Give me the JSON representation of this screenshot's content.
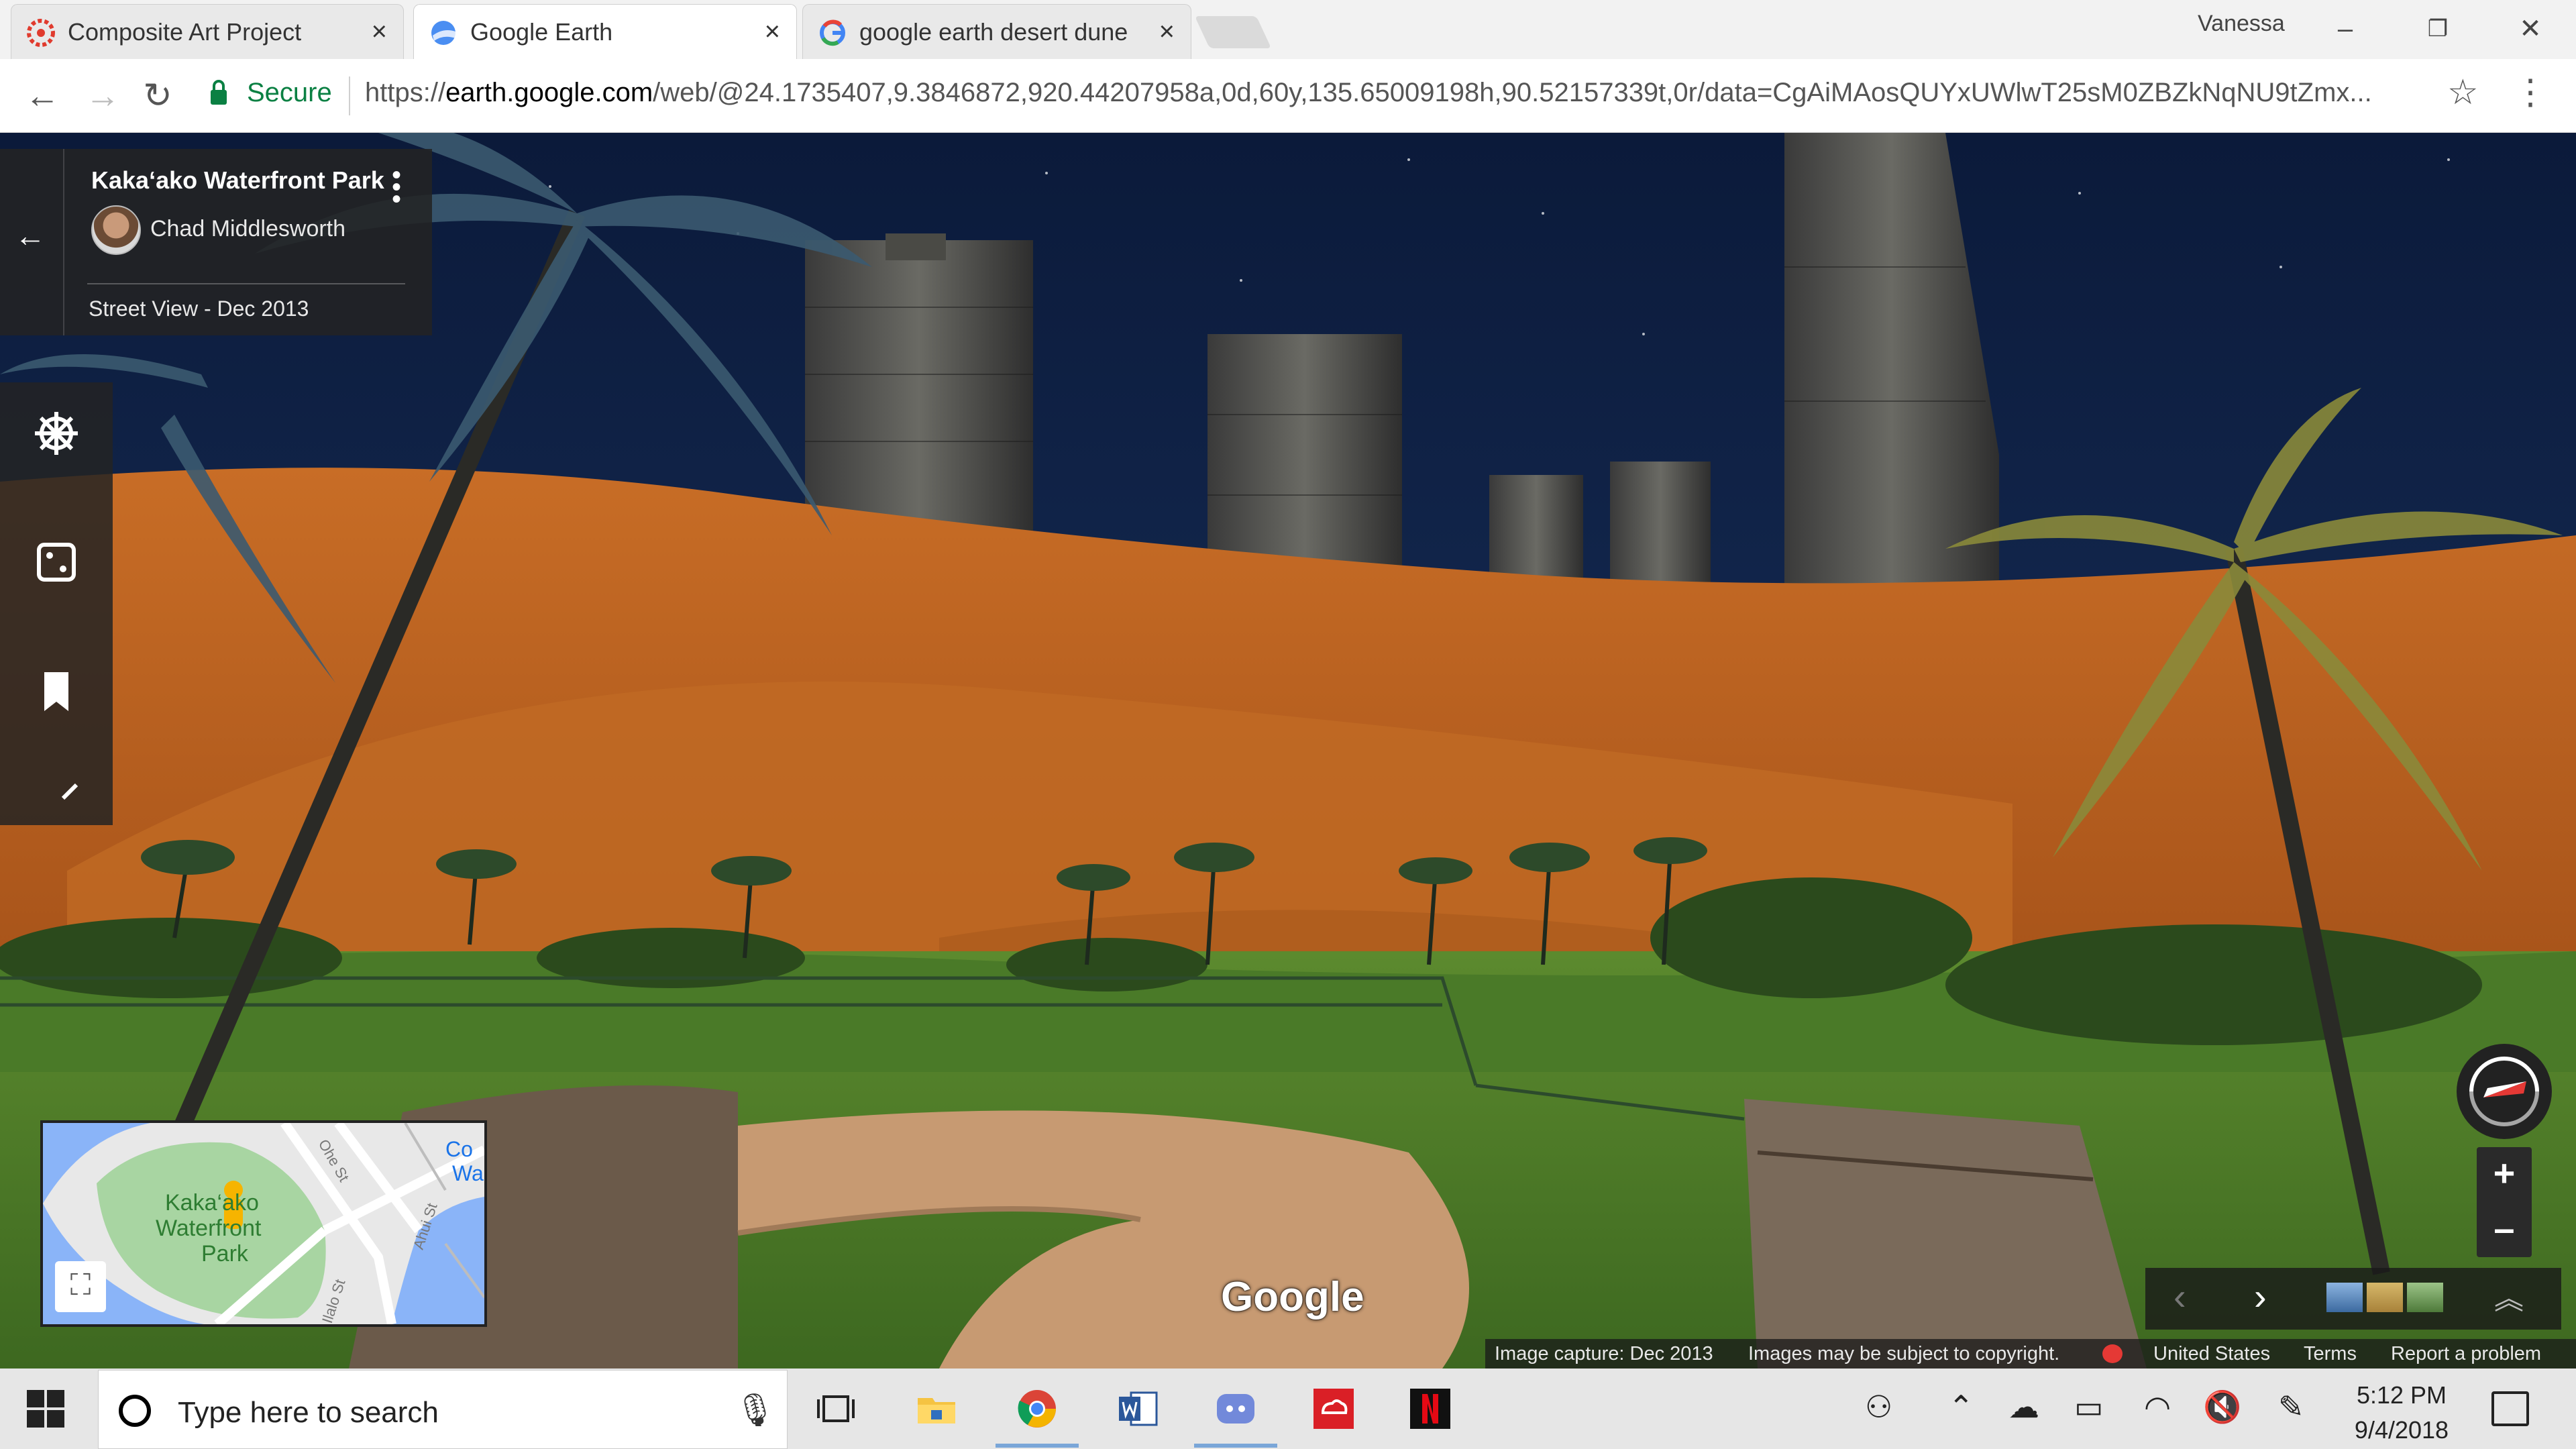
{
  "browser": {
    "tabs": [
      {
        "label": "Composite Art Project",
        "active": false,
        "icon": "canvas-icon"
      },
      {
        "label": "Google Earth",
        "active": true,
        "icon": "google-earth-icon"
      },
      {
        "label": "google earth desert dune",
        "active": false,
        "icon": "google-g-icon"
      }
    ],
    "close_glyph": "×",
    "profile_name": "Vanessa",
    "secure_label": "Secure",
    "url_scheme": "https://",
    "url_domain": "earth.google.com",
    "url_path": "/web/@24.1735407,9.3846872,920.44207958a,0d,60y,135.65009198h,90.52157339t,0r/data=CgAiMAosQUYxUWlwT25sM0ZBZkNqNU9tZmx..."
  },
  "street_view": {
    "place_name": "Kaka‘ako Waterfront Park",
    "author": "Chad Middlesworth",
    "capture": "Street View - Dec 2013"
  },
  "minimap": {
    "labels": [
      "Kaka‘ako",
      "Waterfront",
      "Park"
    ],
    "streets": [
      "Ahui St",
      "Ilalo St",
      "Co",
      "Wa",
      "Ohe St"
    ]
  },
  "watermark": "Google",
  "footer": {
    "capture": "Image capture: Dec 2013",
    "copyright": "Images may be subject to copyright.",
    "region": "United States",
    "terms": "Terms",
    "report": "Report a problem"
  },
  "taskbar": {
    "search_placeholder": "Type here to search",
    "time": "5:12 PM",
    "date": "9/4/2018"
  },
  "colors": {
    "secure_green": "#0b8043",
    "sky_top": "#0b1a3a",
    "sand": "#b8621e"
  }
}
